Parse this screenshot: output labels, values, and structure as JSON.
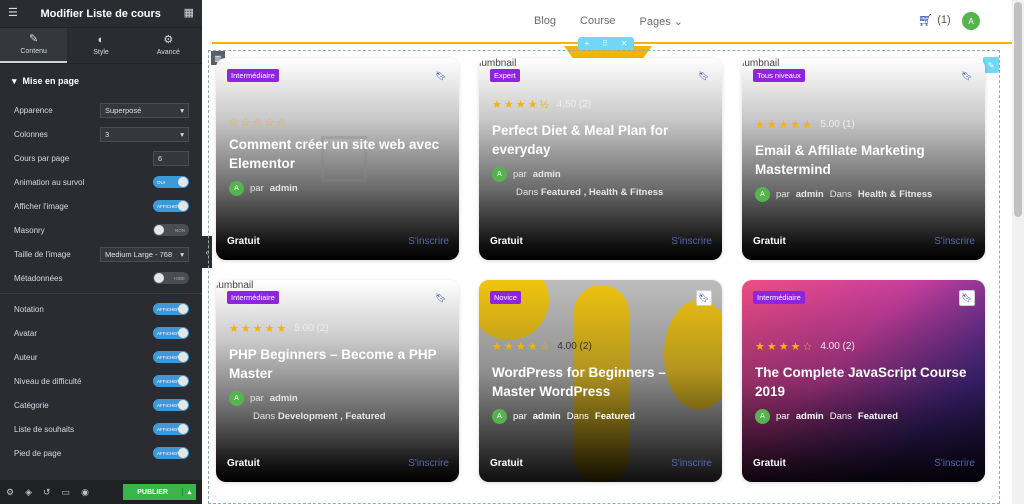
{
  "editor": {
    "title": "Modifier Liste de cours",
    "tabs": [
      {
        "label": "Contenu"
      },
      {
        "label": "Style"
      },
      {
        "label": "Avancé"
      }
    ],
    "section": "Mise en page",
    "controls": {
      "appearance": {
        "label": "Apparence",
        "value": "Superposé"
      },
      "columns": {
        "label": "Colonnes",
        "value": "3"
      },
      "per_page": {
        "label": "Cours par page",
        "value": "6"
      },
      "hover_anim": {
        "label": "Animation au survol",
        "state": "OUI"
      },
      "show_image": {
        "label": "Afficher l'image",
        "state": "AFFICHER"
      },
      "masonry": {
        "label": "Masonry",
        "state": "NON"
      },
      "image_size": {
        "label": "Taille de l'image",
        "value": "Medium Large - 768"
      },
      "metadata": {
        "label": "Métadonnées",
        "state": "HIDE"
      },
      "rating": {
        "label": "Notation",
        "state": "AFFICHER"
      },
      "avatar": {
        "label": "Avatar",
        "state": "AFFICHER"
      },
      "author": {
        "label": "Auteur",
        "state": "AFFICHER"
      },
      "difficulty": {
        "label": "Niveau de difficulté",
        "state": "AFFICHER"
      },
      "category": {
        "label": "Catégorie",
        "state": "AFFICHER"
      },
      "wishlist": {
        "label": "Liste de souhaits",
        "state": "AFFICHER"
      },
      "footer": {
        "label": "Pied de page",
        "state": "AFFICHER"
      }
    },
    "publish": "PUBLIER"
  },
  "header": {
    "nav": [
      "Blog",
      "Course",
      "Pages"
    ],
    "cart_count": "(1)",
    "avatar": "A"
  },
  "courses": [
    {
      "badge": "Intermédiaire",
      "badge_color": "#8e24e0",
      "thumb_alt": "",
      "title": "Comment créer un site web avec Elementor",
      "rating": "",
      "author_prefix": "par",
      "author": "admin",
      "categories_prefix": "",
      "categories": "",
      "price": "Gratuit",
      "cta": "S'inscrire"
    },
    {
      "badge": "Expert",
      "badge_color": "#8e24e0",
      "thumb_alt": "thumbnail",
      "title": "Perfect Diet & Meal Plan for everyday",
      "rating": "4.50 (2)",
      "author_prefix": "par",
      "author": "admin",
      "categories_prefix": "Dans",
      "categories": "Featured ,  Health & Fitness",
      "price": "Gratuit",
      "cta": "S'inscrire"
    },
    {
      "badge": "Tous niveaux",
      "badge_color": "#8e24e0",
      "thumb_alt": "thumbnail",
      "title": "Email & Affiliate Marketing Mastermind",
      "rating": "5.00 (1)",
      "author_prefix": "par",
      "author": "admin",
      "categories_prefix": "Dans",
      "categories": "Health & Fitness",
      "price": "Gratuit",
      "cta": "S'inscrire"
    },
    {
      "badge": "Intermédiaire",
      "badge_color": "#8e24e0",
      "thumb_alt": "thumbnail",
      "title": "PHP Beginners – Become a PHP Master",
      "rating": "5.00 (2)",
      "author_prefix": "par",
      "author": "admin",
      "categories_prefix": "Dans",
      "categories": "Development ,  Featured",
      "price": "Gratuit",
      "cta": "S'inscrire"
    },
    {
      "badge": "Novice",
      "badge_color": "#8e24e0",
      "thumb_alt": "",
      "title": "WordPress for Beginners – Master WordPress",
      "rating": "4.00 (2)",
      "author_prefix": "par",
      "author": "admin",
      "categories_prefix": "Dans",
      "categories": "Featured",
      "price": "Gratuit",
      "cta": "S'inscrire"
    },
    {
      "badge": "Intermédiaire",
      "badge_color": "#8e24e0",
      "thumb_alt": "",
      "title": "The Complete JavaScript Course 2019",
      "rating": "4.00 (2)",
      "author_prefix": "par",
      "author": "admin",
      "categories_prefix": "Dans",
      "categories": "Featured",
      "price": "Gratuit",
      "cta": "S'inscrire"
    }
  ],
  "colors": {
    "accent": "#f4b400",
    "badge": "#8e24e0",
    "publish": "#39b54a",
    "cart": "#2441a8"
  }
}
